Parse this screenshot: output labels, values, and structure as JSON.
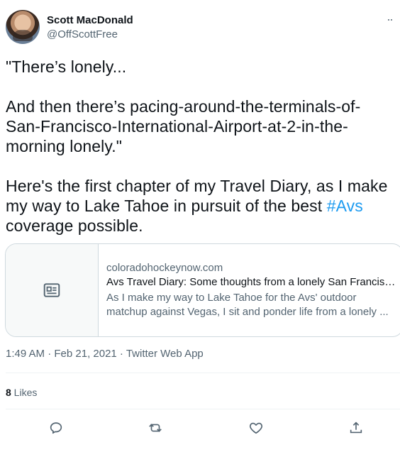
{
  "user": {
    "name": "Scott MacDonald",
    "handle": "@OffScottFree"
  },
  "tweet": {
    "text_before": "\"There’s lonely...\n\nAnd then there’s pacing-around-the-terminals-of-San-Francisco-International-Airport-at-2-in-the-morning lonely.\"\n\nHere's the first chapter of my Travel Diary, as I make my way to Lake Tahoe in pursuit of the best ",
    "hashtag": "#Avs",
    "text_after": "\ncoverage possible."
  },
  "card": {
    "domain": "coloradohockeynow.com",
    "title": "Avs Travel Diary: Some thoughts from a lonely San Francisc...",
    "description": "As I make my way to Lake Tahoe for the Avs' outdoor matchup against Vegas, I sit and ponder life from a lonely ...",
    "icon": "article-icon"
  },
  "meta": {
    "timestamp": "1:49 AM · Feb 21, 2021 · Twitter Web App"
  },
  "stats": {
    "likes_count": "8",
    "likes_label": " Likes"
  },
  "actions": {
    "icons": [
      "reply-icon",
      "retweet-icon",
      "like-icon",
      "share-icon"
    ]
  },
  "colors": {
    "link": "#1d9bf0",
    "secondary_text": "#536471",
    "border": "#cfd9de"
  }
}
